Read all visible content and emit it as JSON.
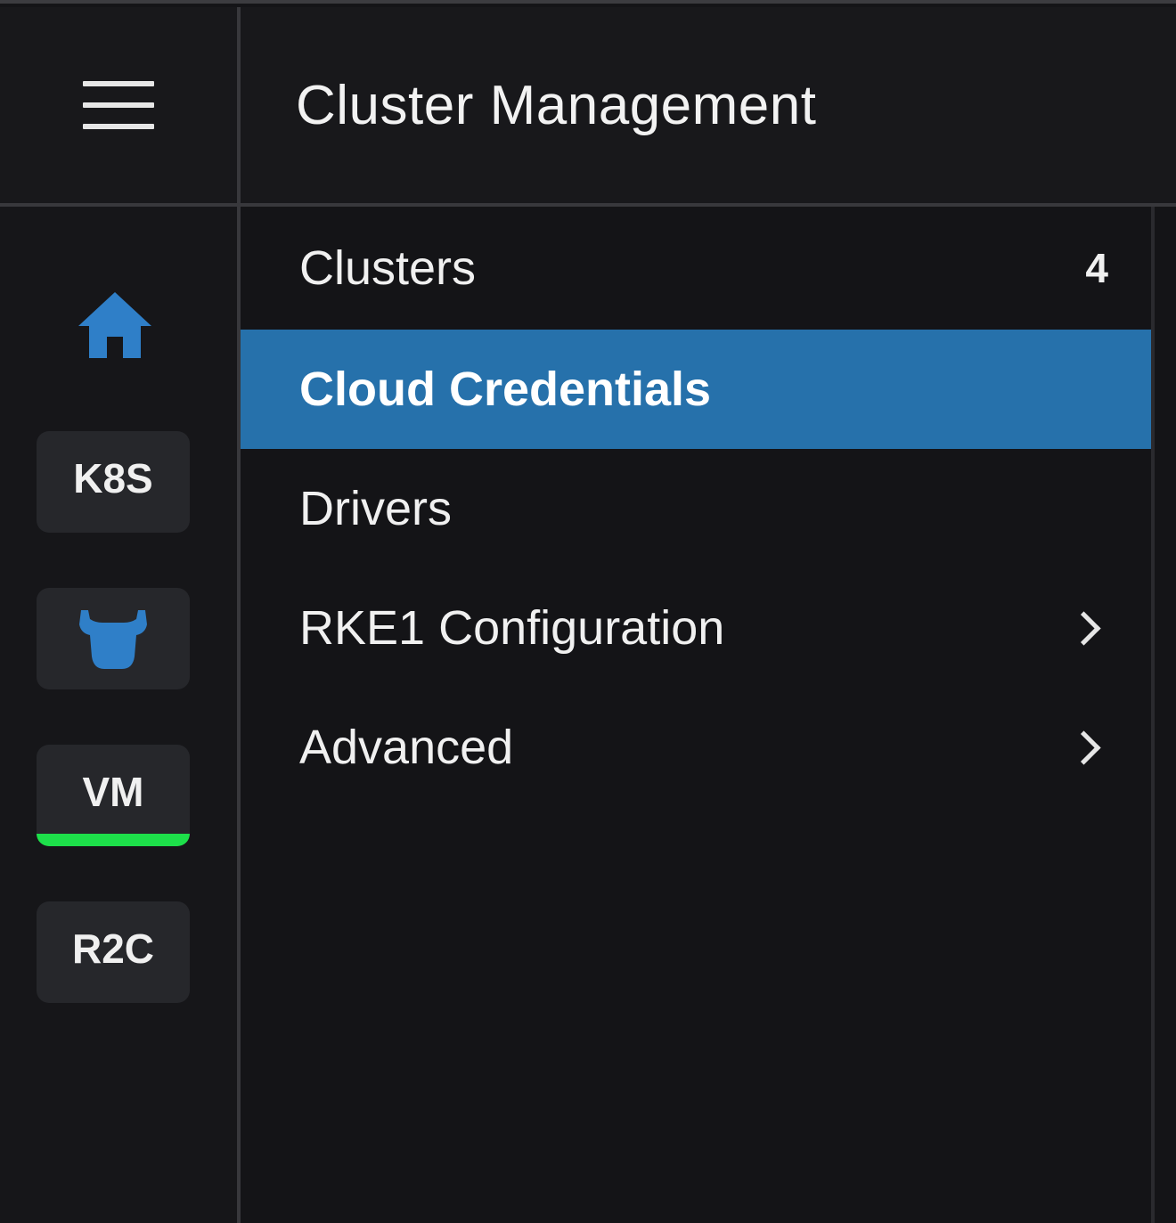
{
  "header": {
    "title": "Cluster Management"
  },
  "rail": {
    "items": [
      {
        "name": "k8s",
        "label": "K8S"
      },
      {
        "name": "bull",
        "label": ""
      },
      {
        "name": "vm",
        "label": "VM",
        "active": true
      },
      {
        "name": "r2c",
        "label": "R2C"
      }
    ]
  },
  "menu": {
    "items": [
      {
        "label": "Clusters",
        "count": "4"
      },
      {
        "label": "Cloud Credentials",
        "selected": true
      },
      {
        "label": "Drivers"
      },
      {
        "label": "RKE1 Configuration",
        "expandable": true
      },
      {
        "label": "Advanced",
        "expandable": true
      }
    ]
  },
  "colors": {
    "accent": "#2671ab",
    "icon_blue": "#2f7fc8",
    "active_indicator": "#1de04a",
    "background": "#141417"
  },
  "icons": [
    "hamburger-icon",
    "home-icon",
    "bull-icon",
    "chevron-right-icon"
  ]
}
